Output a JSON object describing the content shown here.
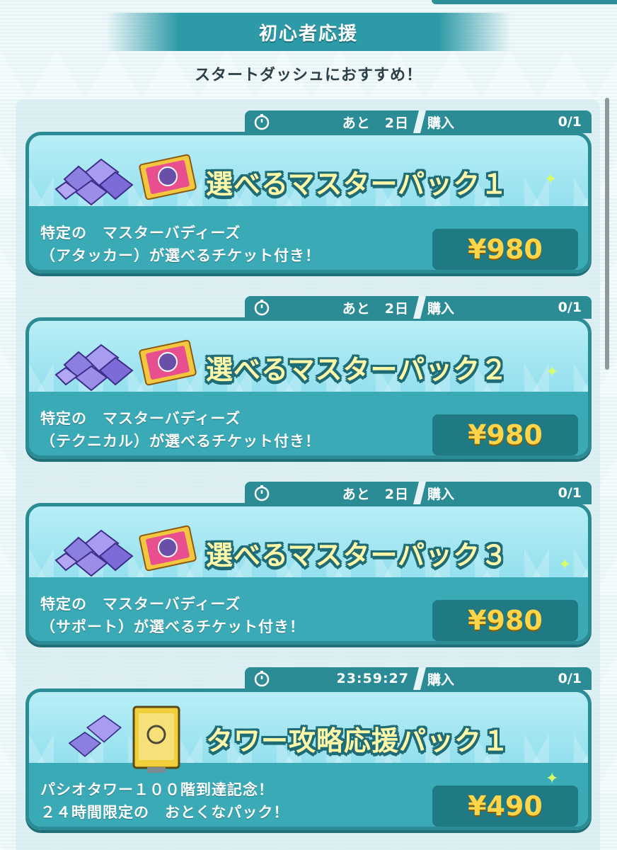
{
  "header": {
    "title": "初心者応援"
  },
  "subtitle": "スタートダッシュにおすすめ！",
  "packs": [
    {
      "timer": "あと　2日",
      "buy_label": "購入",
      "buy_count": "0/1",
      "title": "選べるマスターパック１",
      "description": "特定の　マスターバディーズ\n（アタッカー）が選べるチケット付き！",
      "price": "¥980",
      "icons": [
        "gems-icon",
        "ticket-icon"
      ]
    },
    {
      "timer": "あと　2日",
      "buy_label": "購入",
      "buy_count": "0/1",
      "title": "選べるマスターパック２",
      "description": "特定の　マスターバディーズ\n（テクニカル）が選べるチケット付き！",
      "price": "¥980",
      "icons": [
        "gems-icon",
        "ticket-icon"
      ]
    },
    {
      "timer": "あと　2日",
      "buy_label": "購入",
      "buy_count": "0/1",
      "title": "選べるマスターパック３",
      "description": "特定の　マスターバディーズ\n（サポート）が選べるチケット付き！",
      "price": "¥980",
      "icons": [
        "gems-icon",
        "ticket-icon"
      ]
    },
    {
      "timer": "23:59:27",
      "buy_label": "購入",
      "buy_count": "0/1",
      "title": "タワー攻略応援パック１",
      "description": "パシオタワー１００階到達記念！\n２４時間限定の　おとくなパック！",
      "price": "¥490",
      "icons": [
        "gems-icon",
        "card-icon"
      ]
    }
  ],
  "colors": {
    "accent": "#2b8c96",
    "price_text": "#ffd54a",
    "title_text": "#fff7a8"
  }
}
